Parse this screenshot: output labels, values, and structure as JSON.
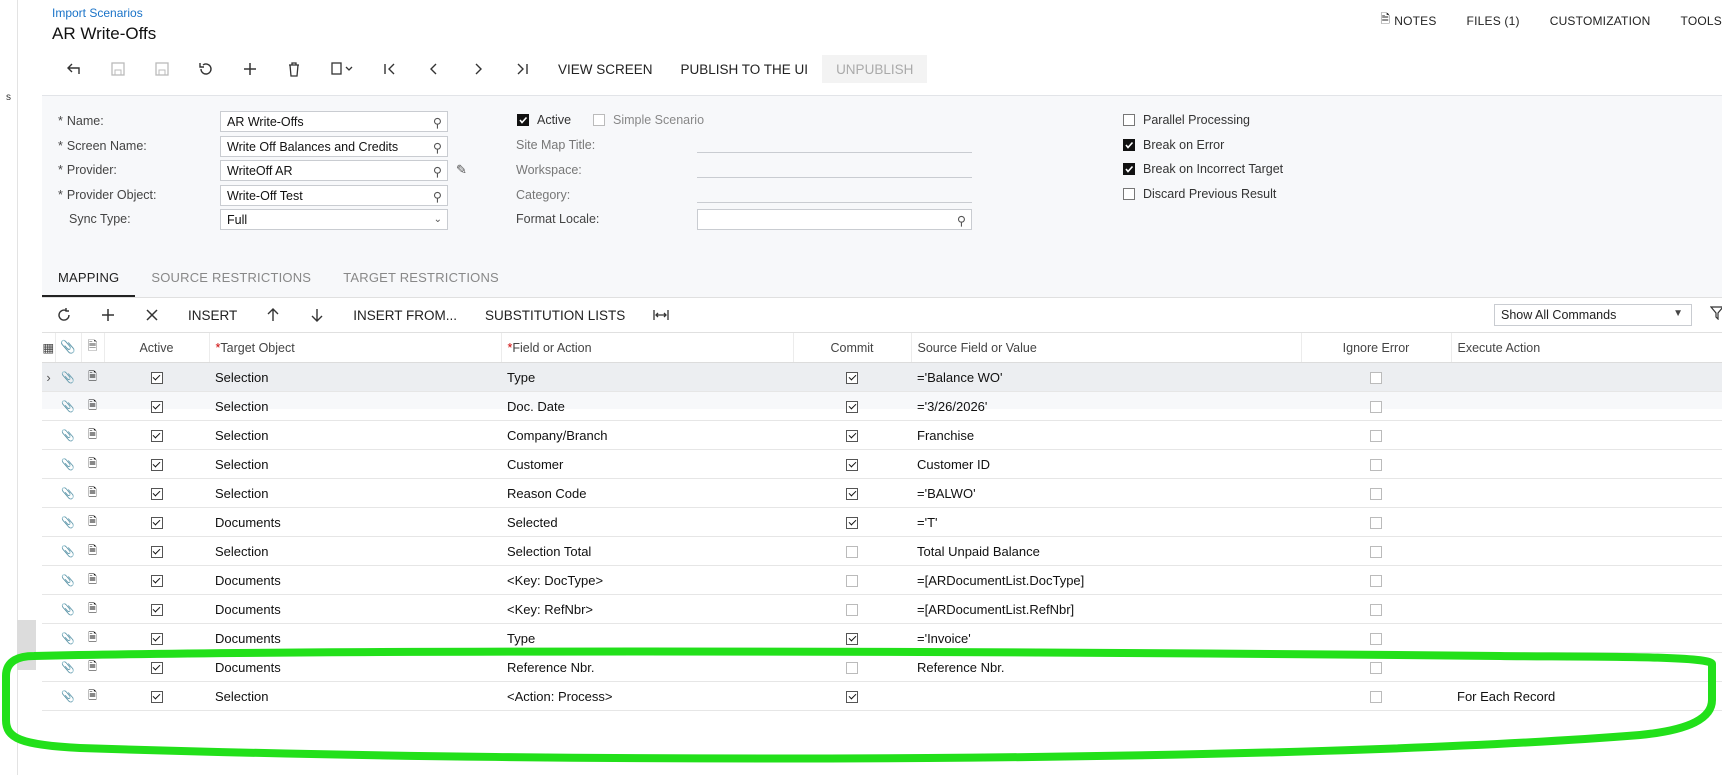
{
  "breadcrumb": "Import Scenarios",
  "title": "AR Write-Offs",
  "top_links": [
    "NOTES",
    "FILES (1)",
    "CUSTOMIZATION",
    "TOOLS"
  ],
  "toolbar": {
    "view_screen": "VIEW SCREEN",
    "publish": "PUBLISH TO THE UI",
    "unpublish": "UNPUBLISH"
  },
  "form": {
    "name_label": "Name:",
    "name_value": "AR Write-Offs",
    "screen_label": "Screen Name:",
    "screen_value": "Write Off Balances and Credits",
    "provider_label": "Provider:",
    "provider_value": "WriteOff AR",
    "provider_object_label": "Provider Object:",
    "provider_object_value": "Write-Off Test",
    "sync_label": "Sync Type:",
    "sync_value": "Full",
    "active_label": "Active",
    "simple_label": "Simple Scenario",
    "sitemap_label": "Site Map Title:",
    "workspace_label": "Workspace:",
    "category_label": "Category:",
    "locale_label": "Format Locale:",
    "parallel_label": "Parallel Processing",
    "break_error_label": "Break on Error",
    "break_target_label": "Break on Incorrect Target",
    "discard_label": "Discard Previous Result"
  },
  "tabs": [
    "MAPPING",
    "SOURCE RESTRICTIONS",
    "TARGET RESTRICTIONS"
  ],
  "grid_toolbar": {
    "insert": "INSERT",
    "insert_from": "INSERT FROM...",
    "substitution": "SUBSTITUTION LISTS",
    "commands": "Show All Commands"
  },
  "columns": {
    "active": "Active",
    "target": "Target Object",
    "field": "Field or Action",
    "commit": "Commit",
    "source": "Source Field or Value",
    "ignore": "Ignore Error",
    "execute": "Execute Action"
  },
  "rows": [
    {
      "target": "Selection",
      "field": "Type",
      "commit": true,
      "source": "='Balance WO'",
      "execute": ""
    },
    {
      "target": "Selection",
      "field": "Doc. Date",
      "commit": true,
      "source": "='3/26/2026'",
      "execute": ""
    },
    {
      "target": "Selection",
      "field": "Company/Branch",
      "commit": true,
      "source": "Franchise",
      "execute": ""
    },
    {
      "target": "Selection",
      "field": "Customer",
      "commit": true,
      "source": "Customer ID",
      "execute": ""
    },
    {
      "target": "Selection",
      "field": "Reason Code",
      "commit": true,
      "source": "='BALWO'",
      "execute": ""
    },
    {
      "target": "Documents",
      "field": "Selected",
      "commit": true,
      "source": "='T'",
      "execute": ""
    },
    {
      "target": "Selection",
      "field": "Selection Total",
      "commit": false,
      "source": "Total Unpaid Balance",
      "execute": ""
    },
    {
      "target": "Documents",
      "field": "<Key: DocType>",
      "commit": false,
      "source": "=[ARDocumentList.DocType]",
      "execute": ""
    },
    {
      "target": "Documents",
      "field": "<Key: RefNbr>",
      "commit": false,
      "source": "=[ARDocumentList.RefNbr]",
      "execute": ""
    },
    {
      "target": "Documents",
      "field": "Type",
      "commit": true,
      "source": "='Invoice'",
      "execute": ""
    },
    {
      "target": "Documents",
      "field": "Reference Nbr.",
      "commit": false,
      "source": "Reference Nbr.",
      "execute": ""
    },
    {
      "target": "Selection",
      "field": "<Action: Process>",
      "commit": true,
      "source": "",
      "execute": "For Each Record"
    }
  ],
  "colors": {
    "highlight": "#22e01a",
    "link": "#1a73c8"
  }
}
